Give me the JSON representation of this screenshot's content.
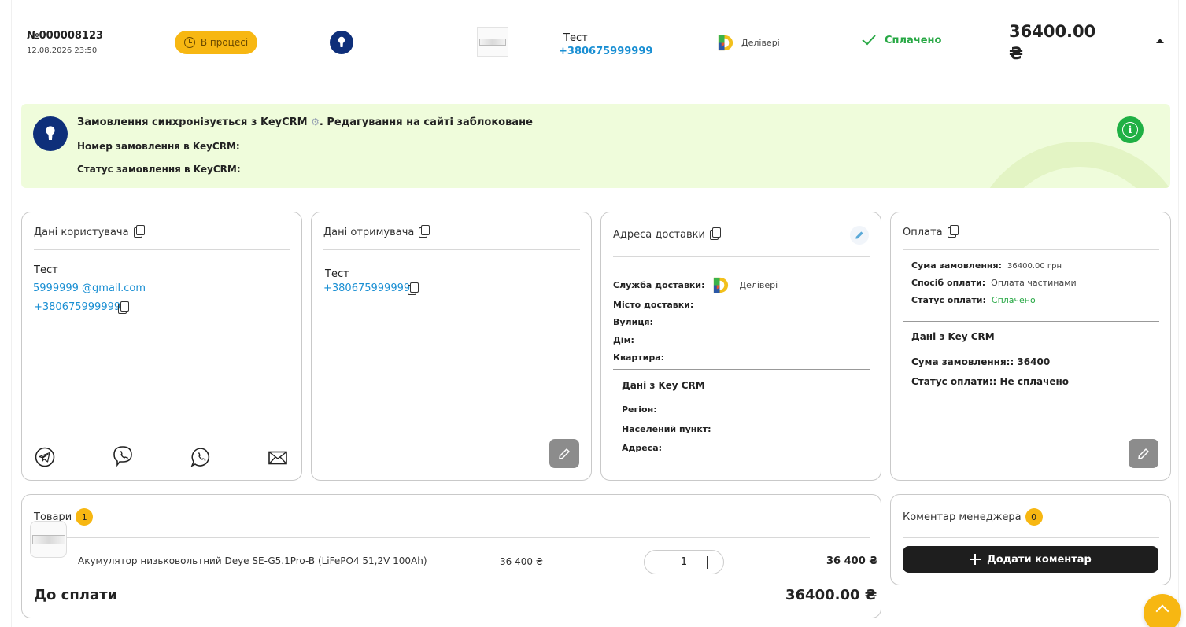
{
  "order": {
    "number": "№000008123",
    "date": "12.08.2026 23:50",
    "status": "В процесі",
    "customer_name": "Тест",
    "customer_phone": "+380675999999",
    "delivery_service": "Делівері",
    "payment_status": "Сплачено",
    "total": "36400.00 ₴"
  },
  "sync_banner": {
    "title_prefix": "Замовлення синхронізується з KeyCRM",
    "title_suffix": ". Редагування на сайті заблоковане",
    "crm_order_label": "Номер замовлення в KeyCRM:",
    "crm_status_label": "Статус замовлення в KeyCRM:"
  },
  "user_card": {
    "title": "Дані користувача",
    "name": "Тест",
    "email": "5999999 @gmail.com",
    "phone": "+380675999999",
    "social_icons": [
      "telegram-icon",
      "viber-icon",
      "whatsapp-icon",
      "mail-icon"
    ]
  },
  "recipient_card": {
    "title": "Дані отримувача",
    "name": "Тест",
    "phone": "+380675999999"
  },
  "delivery_card": {
    "title": "Адреса доставки",
    "service_label": "Служба доставки:",
    "service_name": "Делівері",
    "city_label": "Місто доставки:",
    "street_label": "Вулиця:",
    "house_label": "Дім:",
    "apartment_label": "Квартира:",
    "crm_title": "Дані з Key CRM",
    "region_label": "Регіон:",
    "locality_label": "Населений пункт:",
    "address_label": "Адреса:"
  },
  "payment_card": {
    "title": "Оплата",
    "sum_label": "Сума замовлення:",
    "sum_value": "36400.00 грн",
    "method_label": "Спосіб оплати:",
    "method_value": "Оплата частинами",
    "status_label": "Статус оплати:",
    "status_value": "Сплачено",
    "crm_title": "Дані з Key CRM",
    "crm_sum": "Сума замовлення:: 36400",
    "crm_status": "Статус оплати:: Не сплачено"
  },
  "goods_card": {
    "title": "Товари",
    "count": "1",
    "items": [
      {
        "name": "Акумулятор низьковольтний Deye SE-G5.1Pro-B (LiFePO4 51,2V 100Ah)",
        "price": "36 400 ₴",
        "qty": "1",
        "sum": "36 400 ₴"
      }
    ],
    "to_pay_label": "До сплати",
    "to_pay_value": "36400.00 ₴"
  },
  "comment_card": {
    "title": "Коментар менеджера",
    "count": "0",
    "add_label": "Додати коментар"
  },
  "colors": {
    "accent": "#f7b712",
    "link": "#1a8fd3",
    "success": "#27a844",
    "navy": "#0e2f7a",
    "banner_bg": "#effcdb"
  }
}
